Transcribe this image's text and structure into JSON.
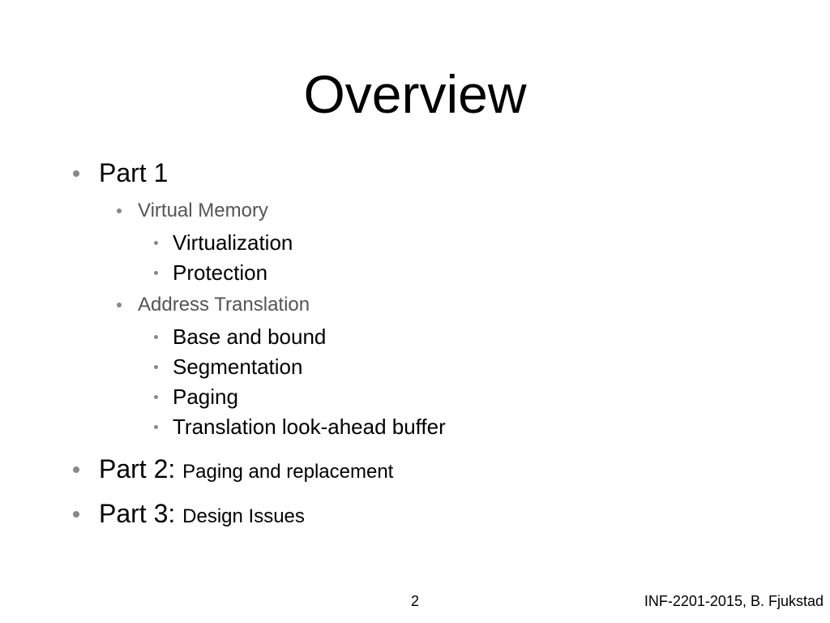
{
  "title": "Overview",
  "parts": [
    {
      "label": "Part 1",
      "sub": "",
      "children": [
        {
          "label": "Virtual Memory",
          "children": [
            {
              "label": "Virtualization"
            },
            {
              "label": "Protection"
            }
          ]
        },
        {
          "label": "Address Translation",
          "children": [
            {
              "label": "Base and bound"
            },
            {
              "label": "Segmentation"
            },
            {
              "label": "Paging"
            },
            {
              "label": "Translation look-ahead buffer"
            }
          ]
        }
      ]
    },
    {
      "label": "Part 2:",
      "sub": "Paging and replacement",
      "children": []
    },
    {
      "label": "Part 3:",
      "sub": "Design Issues",
      "children": []
    }
  ],
  "page_number": "2",
  "footer": "INF-2201-2015, B. Fjukstad"
}
